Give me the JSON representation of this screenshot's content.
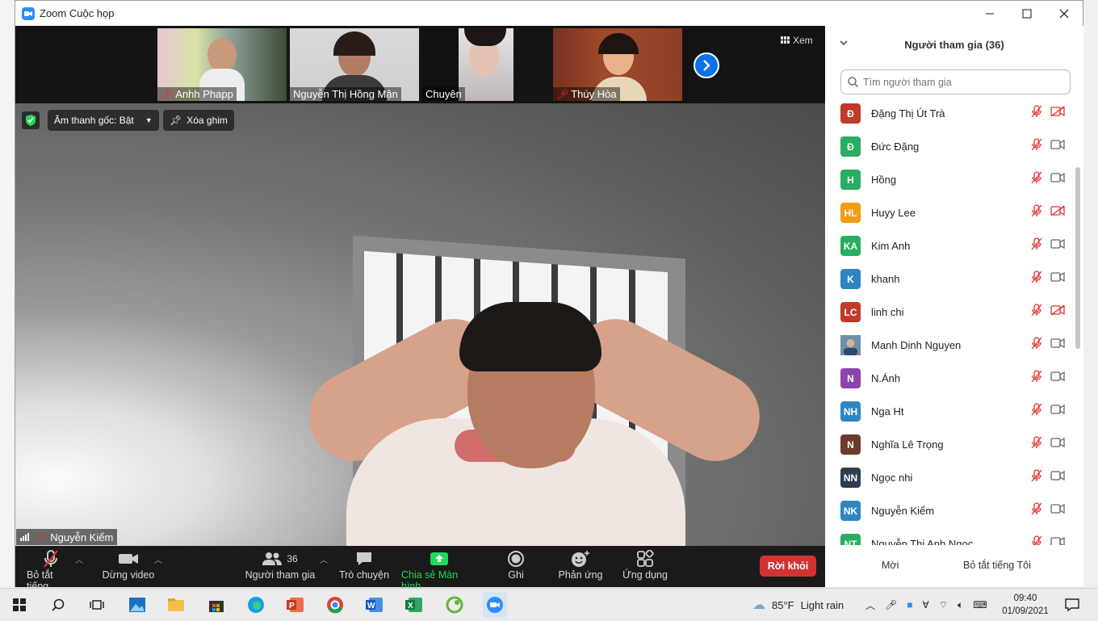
{
  "window": {
    "title": "Zoom Cuộc họp"
  },
  "thumbnails": [
    {
      "name": "Anhh Phapp"
    },
    {
      "name": "Nguyễn Thị Hồng Mận"
    },
    {
      "name": "Chuyên"
    },
    {
      "name": "Thúy Hòa"
    }
  ],
  "view_button": {
    "label": "Xem"
  },
  "main_video": {
    "audio_label": "Âm thanh gốc: Bật",
    "unpin_label": "Xóa ghim",
    "speaker_name": "Nguyễn Kiểm"
  },
  "toolbar": {
    "mute_label": "Bỏ tắt tiếng",
    "video_label": "Dừng video",
    "participants_label": "Người tham gia",
    "participants_count": "36",
    "chat_label": "Trò chuyện",
    "share_label": "Chia sẻ Màn hình",
    "record_label": "Ghi",
    "reactions_label": "Phản ứng",
    "apps_label": "Ứng dụng",
    "leave_label": "Rời khỏi"
  },
  "panel": {
    "title": "Người tham gia (36)",
    "search_placeholder": "Tìm người tham gia",
    "participants": [
      {
        "initials": "Đ",
        "name": "Đặng Thị Út Trà",
        "color": "#c0392b",
        "video_off": true
      },
      {
        "initials": "Đ",
        "name": "Đức Đặng",
        "color": "#27ae60",
        "video_off": false
      },
      {
        "initials": "H",
        "name": "Hồng",
        "color": "#27ae60",
        "video_off": false
      },
      {
        "initials": "HL",
        "name": "Huyy Lee",
        "color": "#f39c12",
        "video_off": true
      },
      {
        "initials": "KA",
        "name": "Kim Anh",
        "color": "#27ae60",
        "video_off": false
      },
      {
        "initials": "K",
        "name": "khanh",
        "color": "#2e86c1",
        "video_off": false
      },
      {
        "initials": "LC",
        "name": "linh chi",
        "color": "#c0392b",
        "video_off": true
      },
      {
        "initials": "",
        "name": "Manh Dinh Nguyen",
        "color": "#5d8aa8",
        "video_off": false
      },
      {
        "initials": "N",
        "name": "N.Ánh",
        "color": "#8e44ad",
        "video_off": false
      },
      {
        "initials": "NH",
        "name": "Nga Ht",
        "color": "#2e86c1",
        "video_off": false
      },
      {
        "initials": "N",
        "name": "Nghĩa Lê Trọng",
        "color": "#6e3b2a",
        "video_off": false
      },
      {
        "initials": "NN",
        "name": "Ngọc nhi",
        "color": "#2c3e50",
        "video_off": false
      },
      {
        "initials": "NK",
        "name": "Nguyễn Kiểm",
        "color": "#2e86c1",
        "video_off": false
      },
      {
        "initials": "NT",
        "name": "Nguyễn Thị Anh Ngọc",
        "color": "#27ae60",
        "video_off": false
      }
    ],
    "invite_label": "Mời",
    "unmute_me_label": "Bỏ tắt tiếng Tôi"
  },
  "taskbar": {
    "weather_temp": "85°F",
    "weather_text": "Light rain",
    "time": "09:40",
    "date": "01/09/2021"
  }
}
